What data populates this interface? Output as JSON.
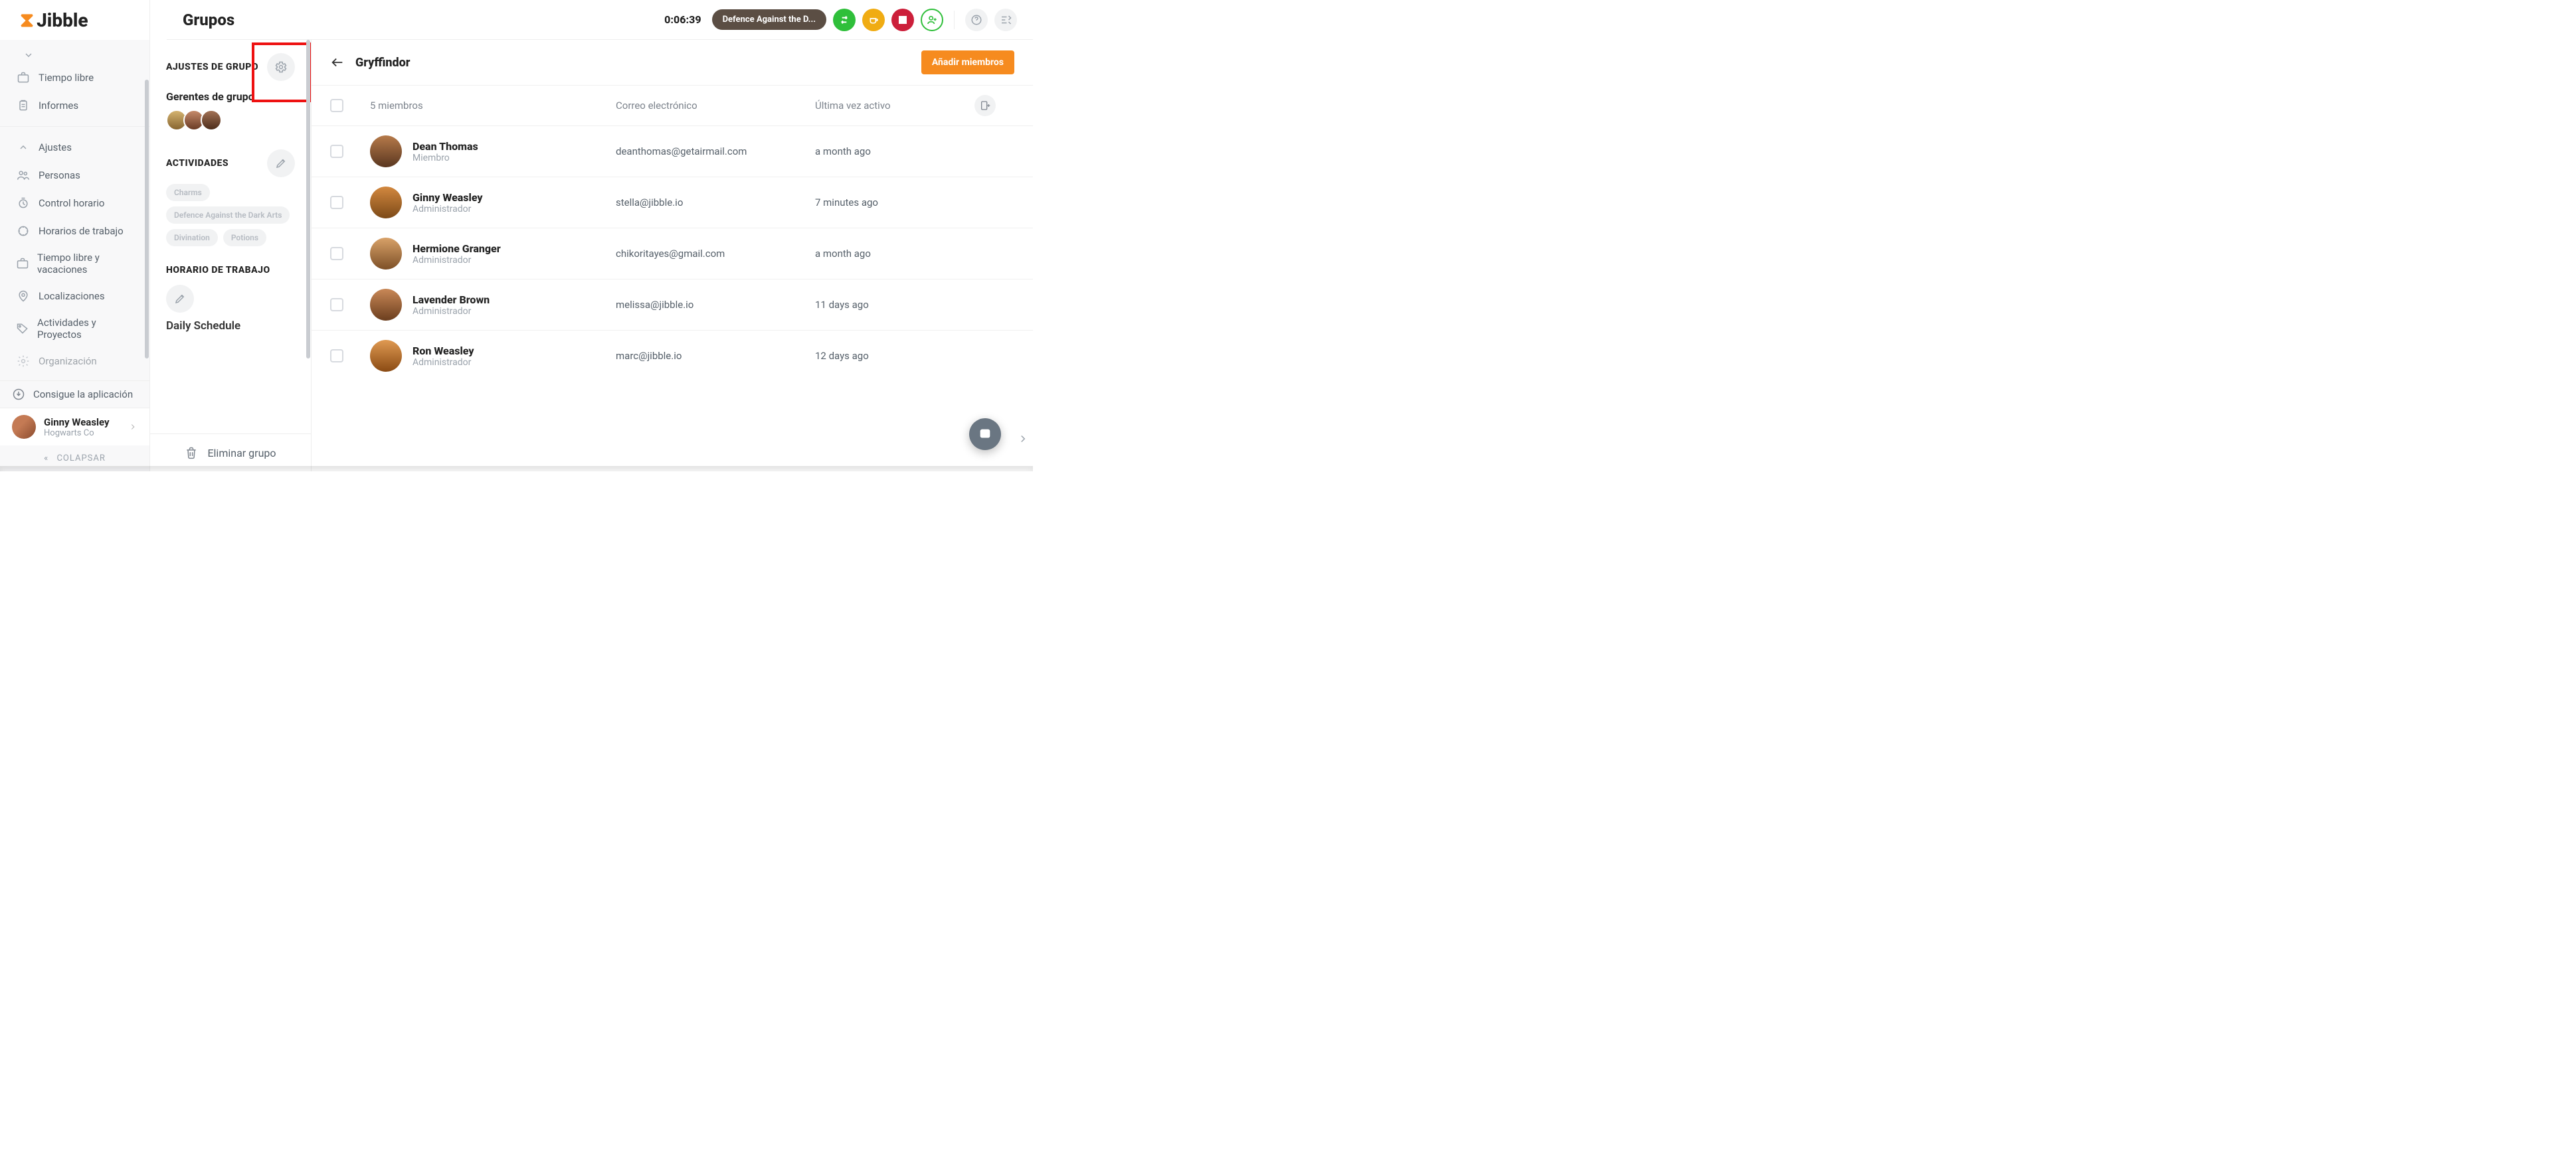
{
  "brand": {
    "name": "Jibble"
  },
  "top": {
    "page_title": "Grupos",
    "timer": "0:06:39",
    "activity_pill": "Defence Against the D..."
  },
  "sidebar": {
    "items": [
      {
        "icon": "chevron-down",
        "label": ""
      },
      {
        "icon": "briefcase",
        "label": "Tiempo libre"
      },
      {
        "icon": "clipboard",
        "label": "Informes"
      }
    ],
    "settings": [
      {
        "icon": "chevron-up",
        "label": "Ajustes"
      },
      {
        "icon": "people",
        "label": "Personas"
      },
      {
        "icon": "clock-check",
        "label": "Control horario"
      },
      {
        "icon": "calendar",
        "label": "Horarios de trabajo"
      },
      {
        "icon": "briefcase",
        "label": "Tiempo libre y vacaciones"
      },
      {
        "icon": "pin",
        "label": "Localizaciones"
      },
      {
        "icon": "tag",
        "label": "Actividades y Proyectos"
      },
      {
        "icon": "gear",
        "label": "Organización"
      }
    ],
    "get_app": "Consigue la aplicación",
    "user": {
      "name": "Ginny Weasley",
      "org": "Hogwarts Co"
    },
    "collapse": "COLAPSAR"
  },
  "mid": {
    "section_group_settings": "AJUSTES DE GRUPO",
    "managers_title": "Gerentes de grupo",
    "section_activities": "ACTIVIDADES",
    "activities": [
      "Charms",
      "Defence Against the Dark Arts",
      "Divination",
      "Potions"
    ],
    "section_schedule": "HORARIO DE TRABAJO",
    "schedule_name": "Daily Schedule",
    "delete_group": "Eliminar grupo"
  },
  "main": {
    "group_name": "Gryffindor",
    "add_members": "Añadir miembros",
    "count_label": "5 miembros",
    "col_email": "Correo electrónico",
    "col_last_active": "Última vez activo",
    "members": [
      {
        "name": "Dean Thomas",
        "role": "Miembro",
        "email": "deanthomas@getairmail.com",
        "last": "a month ago",
        "av": "m1"
      },
      {
        "name": "Ginny Weasley",
        "role": "Administrador",
        "email": "stella@jibble.io",
        "last": "7 minutes ago",
        "av": "m2"
      },
      {
        "name": "Hermione Granger",
        "role": "Administrador",
        "email": "chikoritayes@gmail.com",
        "last": "a month ago",
        "av": "m3"
      },
      {
        "name": "Lavender Brown",
        "role": "Administrador",
        "email": "melissa@jibble.io",
        "last": "11 days ago",
        "av": "m4"
      },
      {
        "name": "Ron Weasley",
        "role": "Administrador",
        "email": "marc@jibble.io",
        "last": "12 days ago",
        "av": "m5"
      }
    ]
  }
}
